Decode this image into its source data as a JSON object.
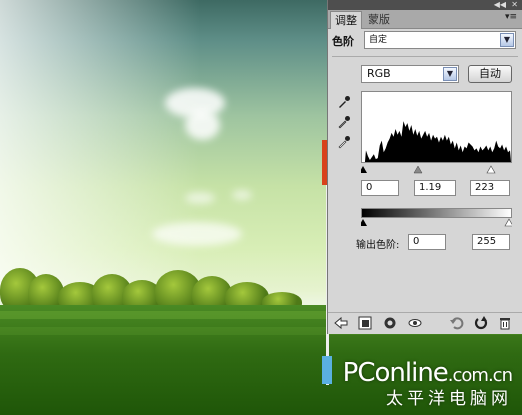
{
  "panel": {
    "tabs": [
      {
        "label": "调整"
      },
      {
        "label": "蒙版"
      }
    ],
    "preset_label": "色阶",
    "preset_value": "自定",
    "channel_value": "RGB",
    "auto_button": "自动",
    "input_levels": {
      "black": "0",
      "gamma": "1.19",
      "white": "223"
    },
    "output_label": "输出色阶:",
    "output_levels": {
      "black": "0",
      "white": "255"
    }
  },
  "watermark": {
    "brand": "PConline",
    "domain": ".com.cn",
    "cn_name": "太平洋电脑网"
  },
  "icons": [
    "collapse-icon",
    "close-icon",
    "panel-menu-icon",
    "dropdown-arrow-icon",
    "black-eyedropper-icon",
    "gray-eyedropper-icon",
    "white-eyedropper-icon",
    "back-arrow-icon",
    "clip-to-layer-icon",
    "layer-visibility-icon",
    "eye-icon",
    "previous-state-icon",
    "reset-icon",
    "trash-icon"
  ]
}
